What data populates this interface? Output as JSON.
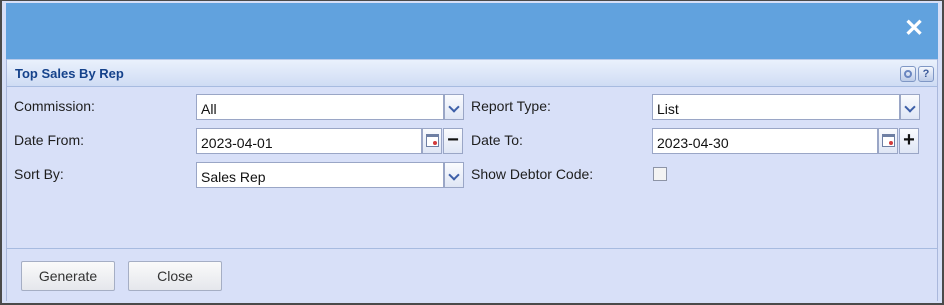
{
  "window": {
    "close_icon": "close-icon"
  },
  "panel": {
    "title": "Top Sales By Rep",
    "tools": {
      "gear_icon": "gear-icon",
      "help_icon": "help-icon",
      "help_glyph": "?"
    }
  },
  "form": {
    "commission": {
      "label": "Commission:",
      "value": "All"
    },
    "report_type": {
      "label": "Report Type:",
      "value": "List"
    },
    "date_from": {
      "label": "Date From:",
      "value": "2023-04-01",
      "step_glyph": "−"
    },
    "date_to": {
      "label": "Date To:",
      "value": "2023-04-30",
      "step_glyph": "+"
    },
    "sort_by": {
      "label": "Sort By:",
      "value": "Sales Rep"
    },
    "show_debtor_code": {
      "label": "Show Debtor Code:",
      "checked": false
    }
  },
  "footer": {
    "generate_label": "Generate",
    "close_label": "Close"
  }
}
